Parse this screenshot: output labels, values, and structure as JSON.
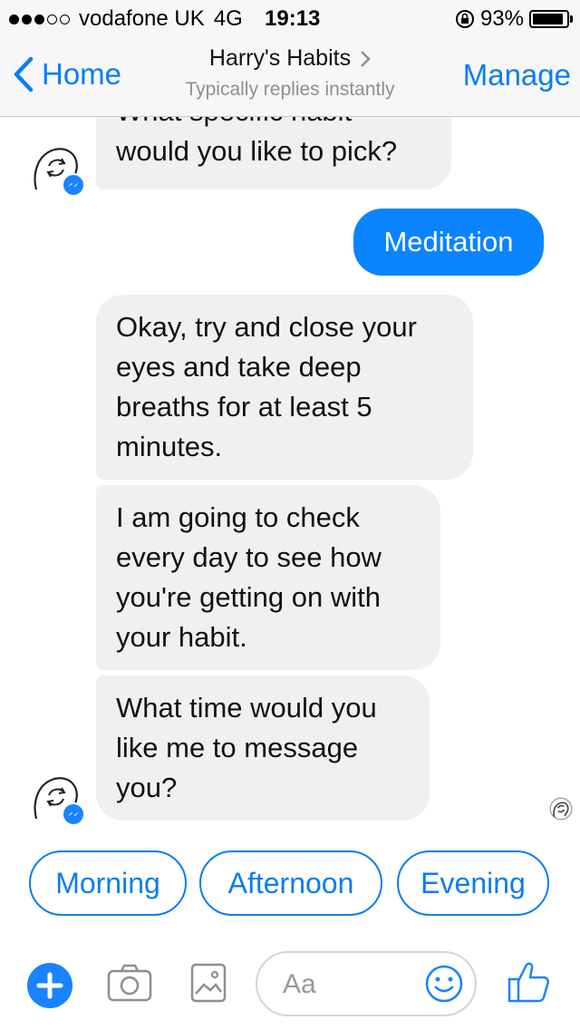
{
  "status_bar": {
    "carrier": "vodafone UK",
    "network": "4G",
    "time": "19:13",
    "battery": "93%",
    "battery_level": 0.93
  },
  "nav": {
    "back_label": "Home",
    "title": "Harry's Habits",
    "subtitle": "Typically replies instantly",
    "manage_label": "Manage"
  },
  "messages": [
    {
      "from": "bot",
      "lines": [
        "What specific habit",
        "would you like to pick?"
      ]
    },
    {
      "from": "user",
      "text": "Meditation"
    },
    {
      "from": "bot",
      "lines": [
        "Okay, try and close your",
        "eyes and take deep",
        "breaths for at least 5",
        "minutes."
      ]
    },
    {
      "from": "bot",
      "lines": [
        "I am going to check",
        "every day to see how",
        "you're getting on with",
        "your habit."
      ]
    },
    {
      "from": "bot",
      "lines": [
        "What time would you",
        "like me to message",
        "you?"
      ]
    }
  ],
  "quick_replies": [
    "Morning",
    "Afternoon",
    "Evening"
  ],
  "composer": {
    "placeholder": "Aa"
  },
  "icons": {
    "back": "chevron-left-icon",
    "title_chevron": "chevron-right-icon",
    "bot_avatar": "habit-loop-avatar-icon",
    "messenger_badge": "messenger-icon",
    "plus": "plus-icon",
    "camera": "camera-icon",
    "gallery": "image-icon",
    "emoji": "smiley-icon",
    "like": "thumbs-up-icon"
  },
  "colors": {
    "accent": "#0a7cf5",
    "outgoing_bubble": "#0a84ff",
    "incoming_bubble": "#f1f0f0"
  }
}
